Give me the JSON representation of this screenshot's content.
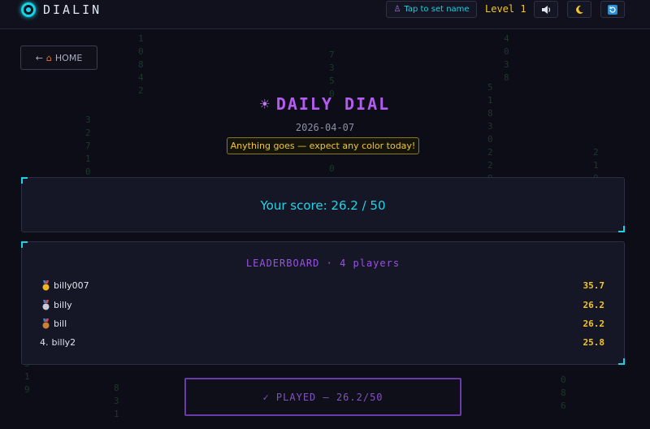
{
  "app": {
    "name": "DIALIN"
  },
  "topbar": {
    "name_button": "Tap to set name",
    "level": "Level 1",
    "sound_icon": "speaker-icon",
    "theme_icon": "moon-icon",
    "refresh_icon": "refresh-icon"
  },
  "nav": {
    "home_label": "HOME"
  },
  "header": {
    "title": "DAILY DIAL",
    "date": "2026-04-07",
    "theme_hint": "Anything goes — expect any color today!"
  },
  "score": {
    "text": "Your score: 26.2 / 50"
  },
  "leaderboard": {
    "title": "LEADERBOARD",
    "player_count": "4 players",
    "entries": [
      {
        "rank": "",
        "medal": "gold",
        "name": "billy007",
        "score": "35.7"
      },
      {
        "rank": "",
        "medal": "silver",
        "name": "billy",
        "score": "26.2"
      },
      {
        "rank": "",
        "medal": "bronze",
        "name": "bill",
        "score": "26.2"
      },
      {
        "rank": "4.",
        "medal": "",
        "name": "billy2",
        "score": "25.8"
      }
    ]
  },
  "played_button": {
    "label": "✓ PLAYED — 26.2/50"
  },
  "colors": {
    "accent_cyan": "#16d4e8",
    "accent_purple": "#b55bf2",
    "accent_yellow": "#f3c624",
    "background": "#0c0d16"
  }
}
